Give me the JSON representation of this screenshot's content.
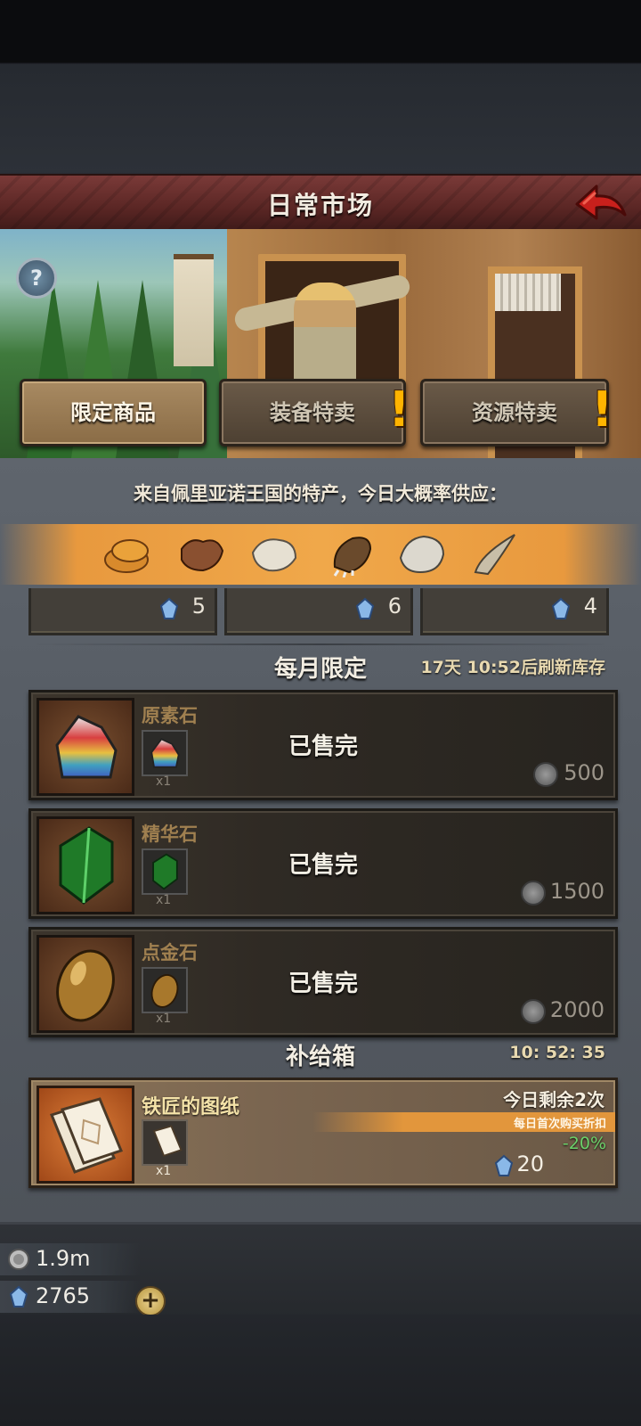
{
  "header": {
    "title": "日常市场"
  },
  "tabs": [
    {
      "label": "限定商品",
      "active": true,
      "alert": false
    },
    {
      "label": "装备特卖",
      "active": false,
      "alert": true
    },
    {
      "label": "资源特卖",
      "active": false,
      "alert": true
    }
  ],
  "help": {
    "label": "?"
  },
  "specialty": {
    "text": "来自佩里亚诺王国的特产，今日大概率供应：",
    "items": [
      "bread-icon",
      "leather-hide-icon",
      "white-fur-icon",
      "claw-paw-icon",
      "fleece-icon",
      "horn-icon"
    ]
  },
  "top_slots": [
    {
      "count": "5"
    },
    {
      "count": "6"
    },
    {
      "count": "4"
    }
  ],
  "monthly": {
    "title": "每月限定",
    "refresh": "17天 10:52后刷新库存",
    "items": [
      {
        "name": "原素石",
        "qty": "x1",
        "status": "已售完",
        "price": "500",
        "icon": "rainbow-rock-icon"
      },
      {
        "name": "精华石",
        "qty": "x1",
        "status": "已售完",
        "price": "1500",
        "icon": "green-crystal-icon"
      },
      {
        "name": "点金石",
        "qty": "x1",
        "status": "已售完",
        "price": "2000",
        "icon": "golden-egg-stone-icon"
      }
    ]
  },
  "supply": {
    "title": "补给箱",
    "timer": "10: 52: 35",
    "item": {
      "name": "铁匠的图纸",
      "qty": "x1",
      "remaining": "今日剩余2次",
      "discount_note": "每日首次购买折扣",
      "discount": "-20%",
      "price": "20",
      "icon": "blueprint-scroll-icon"
    }
  },
  "currency": {
    "silver": "1.9m",
    "gems": "2765",
    "add_label": "+"
  },
  "colors": {
    "title_bar": "#5a2624",
    "accent_orange": "#e8993e",
    "discount_green": "#6cd26a",
    "panel": "#5a6068"
  }
}
